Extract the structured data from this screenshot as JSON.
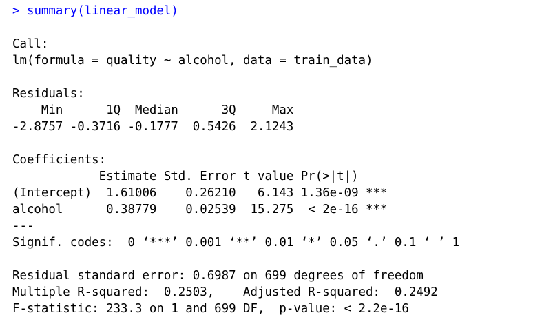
{
  "console": {
    "prompt": ">",
    "command": "summary(linear_model)",
    "call_header": "Call:",
    "call_formula": "lm(formula = quality ~ alcohol, data = train_data)",
    "residuals_header": "Residuals:",
    "residuals_labels": "    Min      1Q  Median      3Q     Max ",
    "residuals_values": "-2.8757 -0.3716 -0.1777  0.5426  2.1243 ",
    "coefficients_header": "Coefficients:",
    "coef_col_header": "            Estimate Std. Error t value Pr(>|t|)    ",
    "coef_intercept": "(Intercept)  1.61006    0.26210   6.143 1.36e-09 ***",
    "coef_alcohol": "alcohol      0.38779    0.02539  15.275  < 2e-16 ***",
    "separator": "---",
    "signif_codes": "Signif. codes:  0 ‘***’ 0.001 ‘**’ 0.01 ‘*’ 0.05 ‘.’ 0.1 ‘ ’ 1",
    "residual_se": "Residual standard error: 0.6987 on 699 degrees of freedom",
    "r_squared": "Multiple R-squared:  0.2503,\tAdjusted R-squared:  0.2492 ",
    "f_statistic": "F-statistic: 233.3 on 1 and 699 DF,  p-value: < 2.2e-16"
  },
  "colors": {
    "command": "#0000ff",
    "output": "#000000",
    "background": "#ffffff"
  }
}
